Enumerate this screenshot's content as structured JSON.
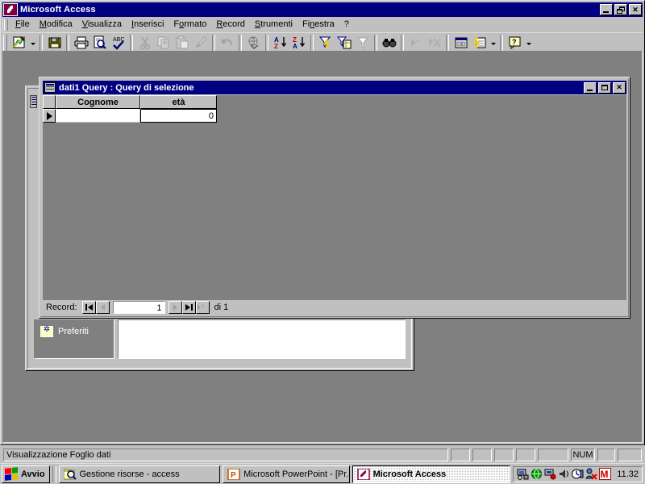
{
  "app": {
    "title": "Microsoft Access",
    "icon": "access-key-icon",
    "window_buttons": {
      "minimize": "_",
      "restore": "restore",
      "close": "X"
    }
  },
  "menubar": {
    "items": [
      {
        "label": "File",
        "accel": "F"
      },
      {
        "label": "Modifica",
        "accel": "M"
      },
      {
        "label": "Visualizza",
        "accel": "V"
      },
      {
        "label": "Inserisci",
        "accel": "I"
      },
      {
        "label": "Formato",
        "accel": "o"
      },
      {
        "label": "Record",
        "accel": "R"
      },
      {
        "label": "Strumenti",
        "accel": "S"
      },
      {
        "label": "Finestra",
        "accel": "n"
      },
      {
        "label": "?",
        "accel": ""
      }
    ]
  },
  "toolbar": {
    "buttons": [
      {
        "name": "view-design-icon",
        "tip": "Visualizza",
        "dropdown": true
      },
      {
        "name": "save-icon",
        "tip": "Salva",
        "dropdown": false
      },
      {
        "name": "print-icon",
        "tip": "Stampa",
        "dropdown": false
      },
      {
        "name": "print-preview-icon",
        "tip": "Anteprima di stampa",
        "dropdown": false
      },
      {
        "name": "spellcheck-icon",
        "tip": "Controllo ortografia",
        "dropdown": false
      },
      {
        "name": "cut-icon",
        "tip": "Taglia",
        "dropdown": false
      },
      {
        "name": "copy-icon",
        "tip": "Copia",
        "dropdown": false
      },
      {
        "name": "paste-icon",
        "tip": "Incolla",
        "dropdown": false
      },
      {
        "name": "format-painter-icon",
        "tip": "Copia formato",
        "dropdown": false
      },
      {
        "name": "undo-icon",
        "tip": "Annulla",
        "dropdown": false
      },
      {
        "name": "insert-hyperlink-icon",
        "tip": "Inserisci collegamento ipertestuale",
        "dropdown": false
      },
      {
        "name": "sort-ascending-icon",
        "tip": "Ordinamento crescente",
        "dropdown": false
      },
      {
        "name": "sort-descending-icon",
        "tip": "Ordinamento decrescente",
        "dropdown": false
      },
      {
        "name": "filter-by-selection-icon",
        "tip": "Filtro in base a selezione",
        "dropdown": false
      },
      {
        "name": "filter-by-form-icon",
        "tip": "Filtro in base a maschera",
        "dropdown": false
      },
      {
        "name": "apply-filter-icon",
        "tip": "Applica filtro",
        "dropdown": false
      },
      {
        "name": "find-icon",
        "tip": "Trova",
        "dropdown": false
      },
      {
        "name": "new-record-icon",
        "tip": "Nuovo record",
        "dropdown": false
      },
      {
        "name": "delete-record-icon",
        "tip": "Elimina record",
        "dropdown": false
      },
      {
        "name": "database-window-icon",
        "tip": "Finestra Database",
        "dropdown": false
      },
      {
        "name": "new-object-icon",
        "tip": "Nuovo oggetto",
        "dropdown": true
      },
      {
        "name": "help-icon",
        "tip": "Guida rapida",
        "dropdown": true
      }
    ]
  },
  "query_window": {
    "title": "dati1 Query : Query di selezione",
    "icon": "datasheet-icon",
    "window_buttons": {
      "minimize": "_",
      "maximize": "maximize",
      "close": "X"
    },
    "datasheet": {
      "columns": [
        "Cognome",
        "età"
      ],
      "rows": [
        {
          "selected": true,
          "cells": [
            "",
            "0"
          ]
        }
      ]
    },
    "record_nav": {
      "label": "Record:",
      "current": "1",
      "total_label": "di 1",
      "buttons": [
        {
          "name": "first-record-button",
          "glyph": "|<"
        },
        {
          "name": "previous-record-button",
          "glyph": "<"
        },
        {
          "name": "next-record-button",
          "glyph": ">"
        },
        {
          "name": "last-record-button",
          "glyph": ">|"
        },
        {
          "name": "new-record-button",
          "glyph": ">*"
        }
      ]
    }
  },
  "database_window": {
    "favorites_label": "Preferiti",
    "favorites_icon": "favorites-folder-icon"
  },
  "statusbar": {
    "message": "Visualizzazione Foglio dati",
    "indicators": [
      "",
      "",
      "",
      "",
      "",
      "NUM",
      "",
      ""
    ]
  },
  "taskbar": {
    "start_label": "Avvio",
    "start_icon": "windows-logo-icon",
    "buttons": [
      {
        "label": "Gestione risorse - access",
        "icon": "explorer-icon",
        "active": false
      },
      {
        "label": "Microsoft PowerPoint - [Pr...",
        "icon": "powerpoint-icon",
        "active": false
      },
      {
        "label": "Microsoft Access",
        "icon": "access-key-icon",
        "active": true
      }
    ],
    "tray": {
      "icons": [
        "network-icon",
        "globe-icon",
        "modem-icon",
        "volume-icon",
        "clock-icon",
        "users-icon",
        "m-icon"
      ],
      "time": "11.32"
    }
  },
  "colors": {
    "titlebar_active": "#000080",
    "face": "#c0c0c0",
    "desktop": "#808080",
    "mdi_background": "#808080"
  }
}
